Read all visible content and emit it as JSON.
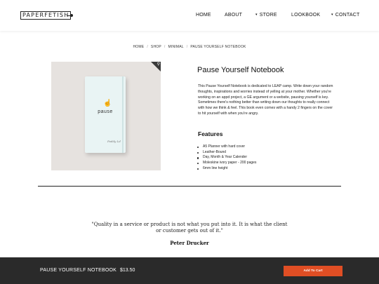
{
  "brand": {
    "logo_text": "PAPERFETISH"
  },
  "nav": {
    "items": [
      {
        "label": "HOME",
        "caret": ""
      },
      {
        "label": "ABOUT",
        "caret": ""
      },
      {
        "label": "STORE",
        "caret": "▾"
      },
      {
        "label": "LOOKBOOK",
        "caret": ""
      },
      {
        "label": "CONTACT",
        "caret": "▾"
      }
    ]
  },
  "breadcrumb": [
    "HOME",
    "SHOP",
    "MINIMAL",
    "PAUSE YOURSELF NOTEBOOK"
  ],
  "product": {
    "title": "Pause Yourself Notebook",
    "image": {
      "cover_word": "pause",
      "cover_signature": "Paddy Ld"
    },
    "description": "This Pause Yourself Notebook is dedicated to LEAP camp. Write down your random thoughts, inspirations and worries instead of yelling at your mother. Whether you're working on an appd project, a GE argument or a website, pausing yourself is key. Sometimes there's nothing better than writing down our thoughts to really connect with how we think & feel. This book even comes with a handy 2 fingers on the cover to hit yourself with when you're angry.",
    "features_heading": "Features",
    "features": [
      "A5 Planner with hard cover",
      "Leather-Bound",
      "Day, Month & Year Calender",
      "Moleskine ivory paper - 200 pages",
      "6mm line height"
    ]
  },
  "quote": {
    "text": "\"Quality in a service or product is not what you put into it. It is what the client or customer gets out of it.\"",
    "author": "Peter Drucker"
  },
  "sticky_bar": {
    "name": "PAUSE YOURSELF NOTEBOOK",
    "price": "$13.50",
    "button_label": "Add To Cart"
  },
  "colors": {
    "accent": "#e04e24",
    "bar_bg": "#2a2a2a",
    "image_bg": "#e6e2df"
  },
  "icons": {
    "zoom": "magnifier-icon",
    "nav_caret": "caret-down-icon",
    "bullet": "bullet-icon"
  }
}
